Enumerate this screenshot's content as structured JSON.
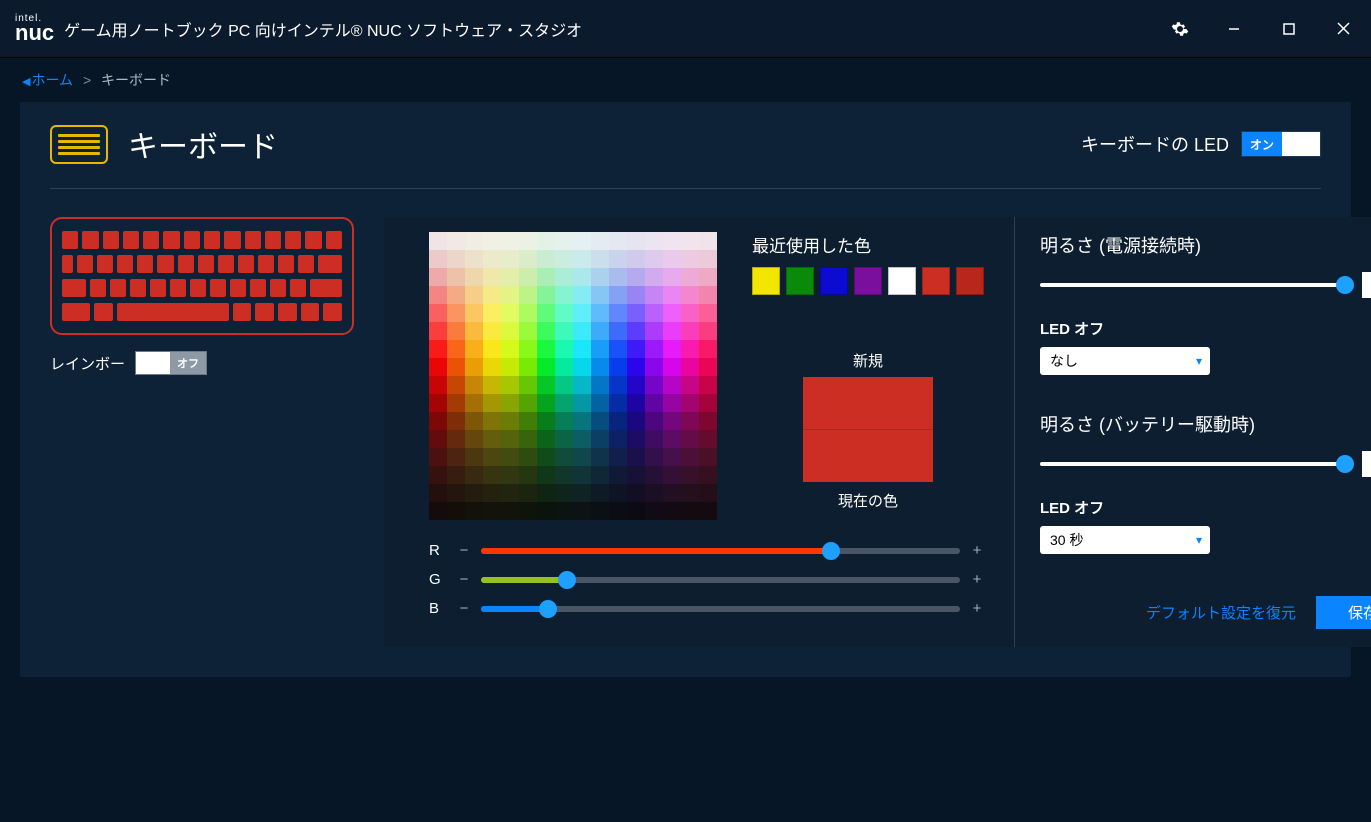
{
  "app_title": "ゲーム用ノートブック PC 向けインテル® NUC ソフトウェア・スタジオ",
  "logo": {
    "line1": "intel.",
    "line2": "nuc"
  },
  "breadcrumb": {
    "home": "ホーム",
    "sep": ">",
    "current": "キーボード"
  },
  "page_title": "キーボード",
  "led_toggle": {
    "label": "キーボードの LED",
    "state": "オン"
  },
  "rainbow": {
    "label": "レインボー",
    "state": "オフ"
  },
  "recent": {
    "title": "最近使用した色",
    "colors": [
      "#f2e600",
      "#0a8a0a",
      "#0b0bd1",
      "#7a0f9e",
      "#ffffff",
      "#cc2e24",
      "#b9261c"
    ]
  },
  "new_color": {
    "label": "新規",
    "hex": "#cc2e24"
  },
  "current_color": {
    "label": "現在の色",
    "hex": "#cc2e24"
  },
  "rgb": {
    "r_label": "R",
    "g_label": "G",
    "b_label": "B",
    "r": 186,
    "g": 46,
    "b": 36
  },
  "right": {
    "bright_ac_label": "明るさ (電源接続時)",
    "bright_ac_value": "100",
    "led_off_label": "LED オフ",
    "led_off_ac_value": "なし",
    "bright_bat_label": "明るさ (バッテリー駆動時)",
    "bright_bat_value": "100",
    "led_off_bat_value": "30 秒",
    "restore": "デフォルト設定を復元",
    "save": "保存"
  }
}
